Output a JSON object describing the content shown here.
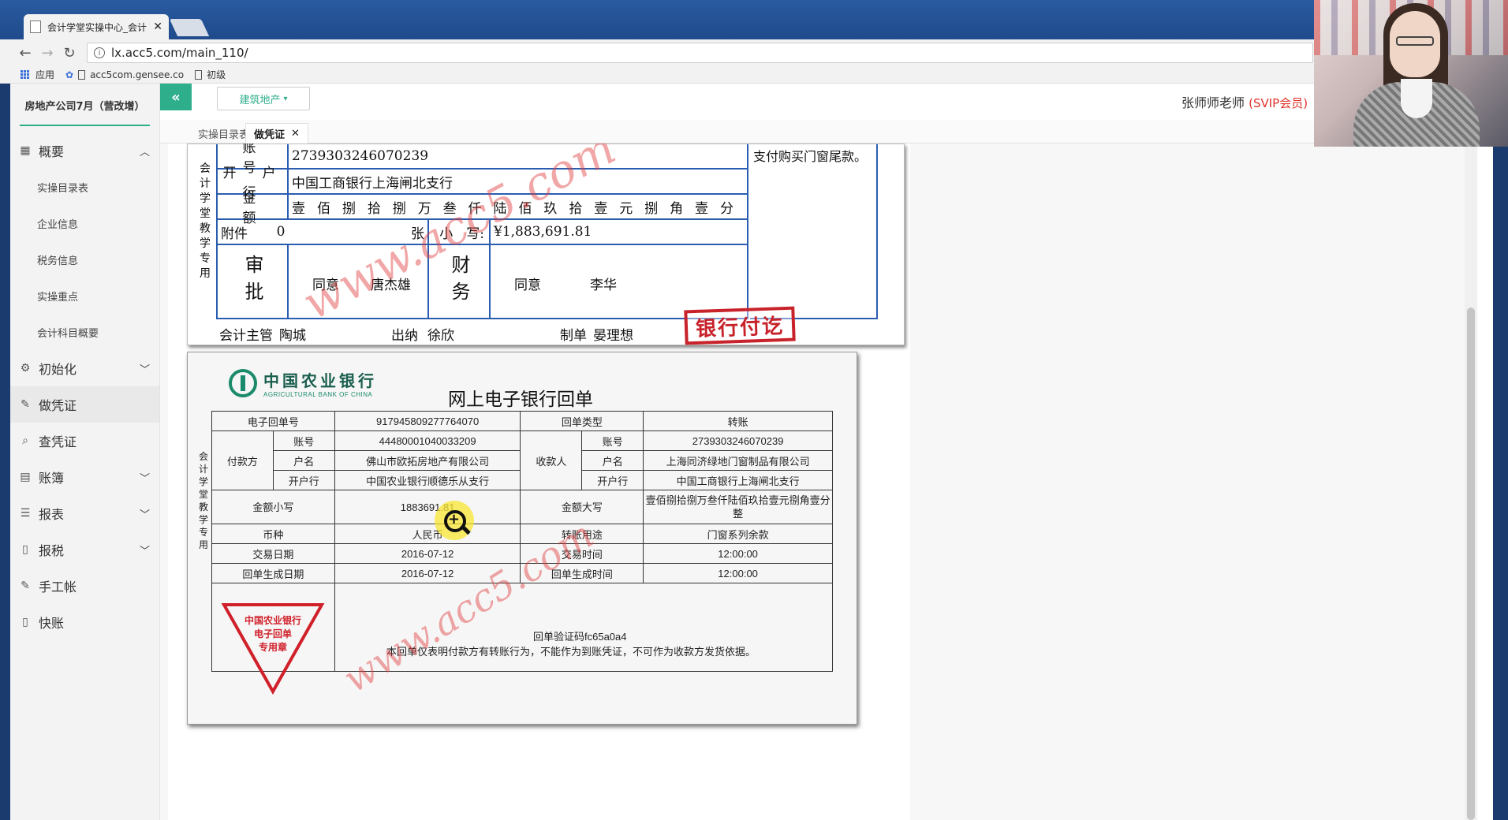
{
  "browser": {
    "tab_title": "会计学堂实操中心_会计",
    "url": "lx.acc5.com/main_110/",
    "bookmarks": [
      "应用",
      "acc5com.gensee.co",
      "初级"
    ]
  },
  "header": {
    "module_dropdown": "建筑地产",
    "user_name": "张师师老师",
    "user_badge": "(SVIP会员)"
  },
  "sidebar": {
    "company": "房地产公司7月（营改增）",
    "groups": [
      {
        "label": "概要",
        "icon": "dashboard-icon",
        "expanded": true,
        "children": [
          "实操目录表",
          "企业信息",
          "税务信息",
          "实操重点",
          "会计科目概要"
        ]
      },
      {
        "label": "初始化",
        "icon": "gear-icon"
      },
      {
        "label": "做凭证",
        "icon": "pen-icon",
        "active": true
      },
      {
        "label": "查凭证",
        "icon": "search-icon"
      },
      {
        "label": "账簿",
        "icon": "book-icon"
      },
      {
        "label": "报表",
        "icon": "report-icon"
      },
      {
        "label": "报税",
        "icon": "file-icon"
      },
      {
        "label": "手工帐",
        "icon": "pen-icon"
      },
      {
        "label": "快账",
        "icon": "file-icon"
      }
    ]
  },
  "page_tabs": [
    {
      "label": "实操目录表"
    },
    {
      "label": "做凭证",
      "active": true
    }
  ],
  "voucher": {
    "side_text": "会计学堂教学专用",
    "account_label": "账　　号",
    "account_value": "2739303246070239",
    "bank_label": "开　户　行",
    "bank_value": "中国工商银行上海闸北支行",
    "amount_label": "金　　额",
    "amount_chars": [
      "壹",
      "佰",
      "捌",
      "拾",
      "捌",
      "万",
      "叁",
      "仟",
      "陆",
      "佰",
      "玖",
      "拾",
      "壹",
      "元",
      "捌",
      "角",
      "壹",
      "分"
    ],
    "attach_label": "附件",
    "attach_count": "0",
    "attach_unit": "张",
    "small_label": "小　写:",
    "small_value": "¥1,883,691.81",
    "remark": "支付购买门窗尾款。",
    "approve_label": "审批",
    "approve_opinion": "同意",
    "approve_person": "唐杰雄",
    "finance_label": "财务",
    "finance_opinion": "同意",
    "finance_person": "李华",
    "stamp": "银行付讫",
    "footer": {
      "supervisor_label": "会计主管",
      "supervisor": "陶城",
      "cashier_label": "出纳",
      "cashier": "徐欣",
      "maker_label": "制单",
      "maker": "晏理想"
    }
  },
  "receipt": {
    "bank_name_cn": "中国农业银行",
    "bank_name_en": "AGRICULTURAL BANK OF CHINA",
    "title": "网上电子银行回单",
    "side_text": "会计学堂教学专用",
    "rows": {
      "receipt_no_label": "电子回单号",
      "receipt_no": "917945809277764070",
      "receipt_type_label": "回单类型",
      "receipt_type": "转账",
      "payer_label": "付款方",
      "payee_label": "收款人",
      "acct_label": "账号",
      "name_label": "户名",
      "bank_label": "开户行",
      "payer_acct": "44480001040033209",
      "payer_name": "佛山市欧拓房地产有限公司",
      "payer_bank": "中国农业银行顺德乐从支行",
      "payee_acct": "2739303246070239",
      "payee_name": "上海同济绿地门窗制品有限公司",
      "payee_bank": "中国工商银行上海闸北支行",
      "amount_small_label": "金额小写",
      "amount_small": "1883691.81",
      "amount_big_label": "金额大写",
      "amount_big": "壹佰捌拾捌万叁仟陆佰玖拾壹元捌角壹分整",
      "currency_label": "币种",
      "currency": "人民币",
      "purpose_label": "转账用途",
      "purpose": "门窗系列余款",
      "trade_date_label": "交易日期",
      "trade_date": "2016-07-12",
      "trade_time_label": "交易时间",
      "trade_time": "12:00:00",
      "gen_date_label": "回单生成日期",
      "gen_date": "2016-07-12",
      "gen_time_label": "回单生成时间",
      "gen_time": "12:00:00"
    },
    "seal_text": [
      "中国农业银行",
      "电子回单",
      "专用章"
    ],
    "verify_code": "回单验证码fc65a0a4",
    "disclaimer": "本回单仅表明付款方有转账行为，不能作为到账凭证，不可作为收款方发货依据。"
  },
  "watermark": "www.acc5.com",
  "colors": {
    "accent": "#2fae8c",
    "voucher_border": "#2a5db0",
    "stamp_red": "#c8222a",
    "vip_red": "#e0322b"
  }
}
